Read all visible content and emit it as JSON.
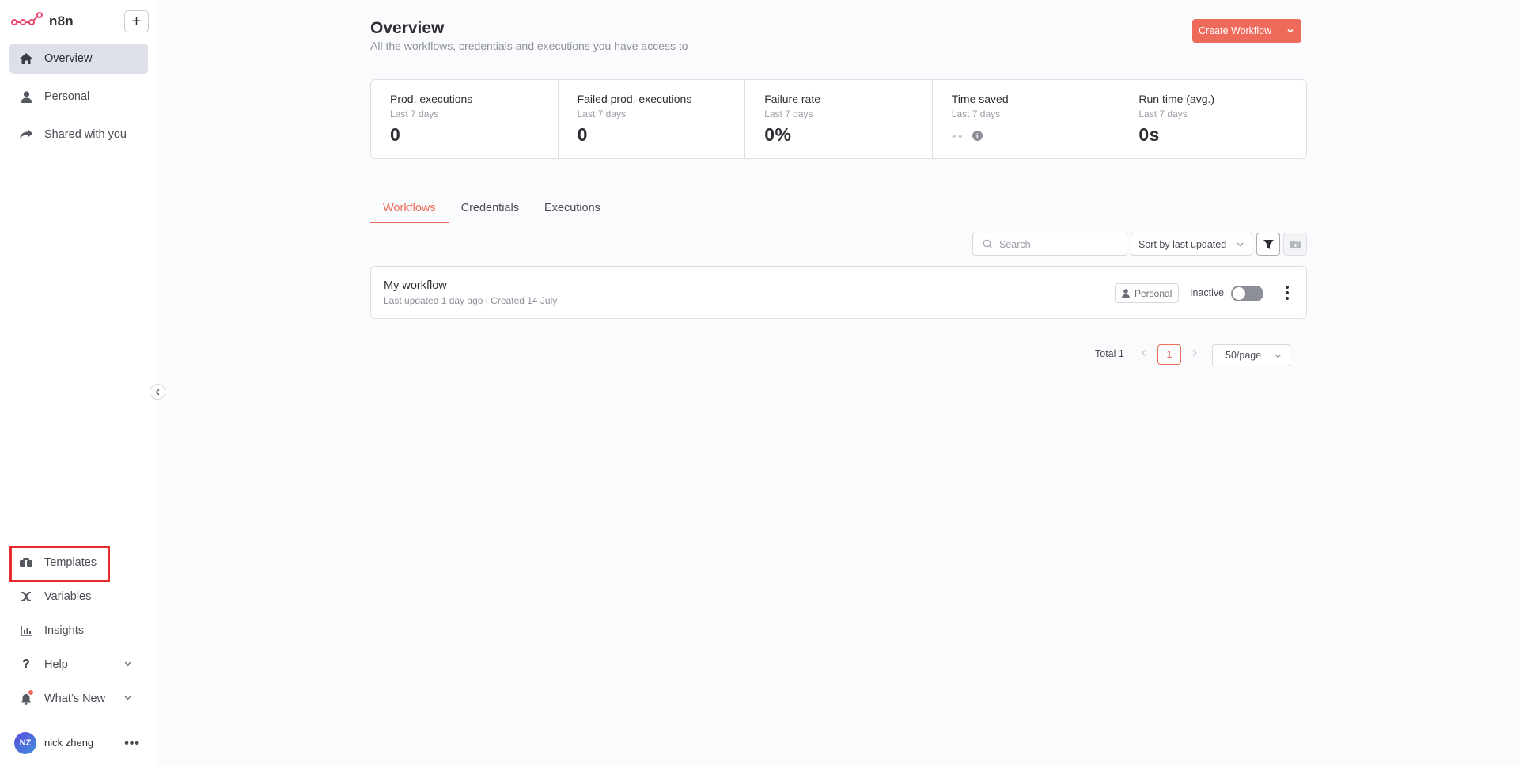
{
  "brand": {
    "name": "n8n"
  },
  "sidebar": {
    "add_label": "+",
    "items": [
      {
        "label": "Overview",
        "icon": "home-icon"
      },
      {
        "label": "Personal",
        "icon": "user-icon"
      },
      {
        "label": "Shared with you",
        "icon": "share-icon"
      }
    ],
    "bottom_items": [
      {
        "label": "Templates",
        "icon": "templates-icon"
      },
      {
        "label": "Variables",
        "icon": "variables-icon"
      },
      {
        "label": "Insights",
        "icon": "chart-icon"
      },
      {
        "label": "Help",
        "icon": "question-icon"
      },
      {
        "label": "What’s New",
        "icon": "bell-icon"
      }
    ],
    "user": {
      "initials": "NZ",
      "name": "nick zheng"
    },
    "user_menu": "•••"
  },
  "header": {
    "title": "Overview",
    "subtitle": "All the workflows, credentials and executions you have access to",
    "create_label": "Create Workflow"
  },
  "stats": [
    {
      "label": "Prod. executions",
      "period": "Last 7 days",
      "value": "0"
    },
    {
      "label": "Failed prod. executions",
      "period": "Last 7 days",
      "value": "0"
    },
    {
      "label": "Failure rate",
      "period": "Last 7 days",
      "value": "0%"
    },
    {
      "label": "Time saved",
      "period": "Last 7 days",
      "value": "--"
    },
    {
      "label": "Run time (avg.)",
      "period": "Last 7 days",
      "value": "0s"
    }
  ],
  "tabs": [
    {
      "label": "Workflows"
    },
    {
      "label": "Credentials"
    },
    {
      "label": "Executions"
    }
  ],
  "toolbar": {
    "search_placeholder": "Search",
    "sort_label": "Sort by last updated"
  },
  "workflow": {
    "name": "My workflow",
    "meta": "Last updated 1 day ago | Created 14 July",
    "owner": "Personal",
    "status": "Inactive"
  },
  "pagination": {
    "total": "Total 1",
    "page": "1",
    "page_size": "50/page"
  },
  "colors": {
    "accent": "#ee6b5b",
    "highlight": "#e52b2b"
  }
}
